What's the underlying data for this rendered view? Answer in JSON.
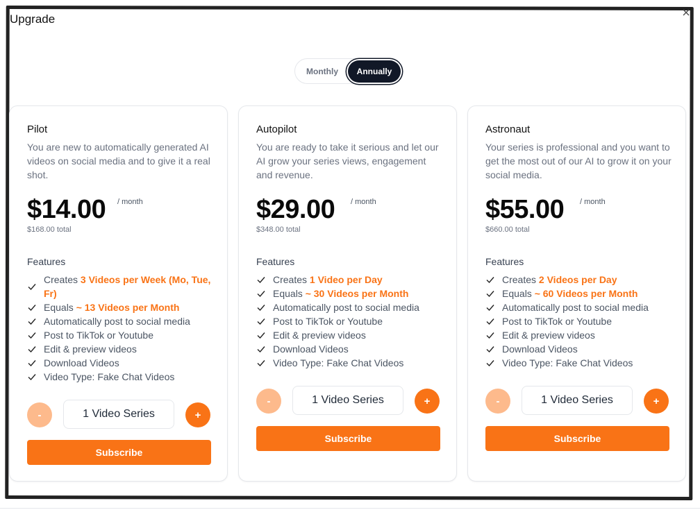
{
  "dialog": {
    "title": "Upgrade",
    "close_icon": "close-icon"
  },
  "billing_toggle": {
    "options": [
      "Monthly",
      "Annually"
    ],
    "selected": "Annually"
  },
  "colors": {
    "accent": "#f97316",
    "accent_light": "#fdba8c",
    "dark": "#111827"
  },
  "plans": [
    {
      "name": "Pilot",
      "description": "You are new to automatically generated AI videos on social media and to give it a real shot.",
      "price": "$14.00",
      "period": "/ month",
      "total": "$168.00 total",
      "features_label": "Features",
      "features": [
        {
          "prefix": "Creates ",
          "highlight": "3 Videos per Week (Mo, Tue, Fr)"
        },
        {
          "prefix": "Equals ",
          "highlight": "~ 13 Videos per Month"
        },
        {
          "prefix": "Automatically post to social media",
          "highlight": ""
        },
        {
          "prefix": "Post to TikTok or Youtube",
          "highlight": ""
        },
        {
          "prefix": "Edit & preview videos",
          "highlight": ""
        },
        {
          "prefix": "Download Videos",
          "highlight": ""
        },
        {
          "prefix": "Video Type: Fake Chat Videos",
          "highlight": ""
        }
      ],
      "minus_label": "-",
      "series_value": "1 Video Series",
      "plus_label": "+",
      "subscribe_label": "Subscribe"
    },
    {
      "name": "Autopilot",
      "description": "You are ready to take it serious and let our AI grow your series views, engagement and revenue.",
      "price": "$29.00",
      "period": "/ month",
      "total": "$348.00 total",
      "features_label": "Features",
      "features": [
        {
          "prefix": "Creates ",
          "highlight": "1 Video per Day"
        },
        {
          "prefix": "Equals ",
          "highlight": "~ 30 Videos per Month"
        },
        {
          "prefix": "Automatically post to social media",
          "highlight": ""
        },
        {
          "prefix": "Post to TikTok or Youtube",
          "highlight": ""
        },
        {
          "prefix": "Edit & preview videos",
          "highlight": ""
        },
        {
          "prefix": "Download Videos",
          "highlight": ""
        },
        {
          "prefix": "Video Type: Fake Chat Videos",
          "highlight": ""
        }
      ],
      "minus_label": "-",
      "series_value": "1 Video Series",
      "plus_label": "+",
      "subscribe_label": "Subscribe"
    },
    {
      "name": "Astronaut",
      "description": "Your series is professional and you want to get the most out of our AI to grow it on your social media.",
      "price": "$55.00",
      "period": "/ month",
      "total": "$660.00 total",
      "features_label": "Features",
      "features": [
        {
          "prefix": "Creates ",
          "highlight": "2 Videos per Day"
        },
        {
          "prefix": "Equals ",
          "highlight": "~ 60 Videos per Month"
        },
        {
          "prefix": "Automatically post to social media",
          "highlight": ""
        },
        {
          "prefix": "Post to TikTok or Youtube",
          "highlight": ""
        },
        {
          "prefix": "Edit & preview videos",
          "highlight": ""
        },
        {
          "prefix": "Download Videos",
          "highlight": ""
        },
        {
          "prefix": "Video Type: Fake Chat Videos",
          "highlight": ""
        }
      ],
      "minus_label": "-",
      "series_value": "1 Video Series",
      "plus_label": "+",
      "subscribe_label": "Subscribe"
    }
  ]
}
